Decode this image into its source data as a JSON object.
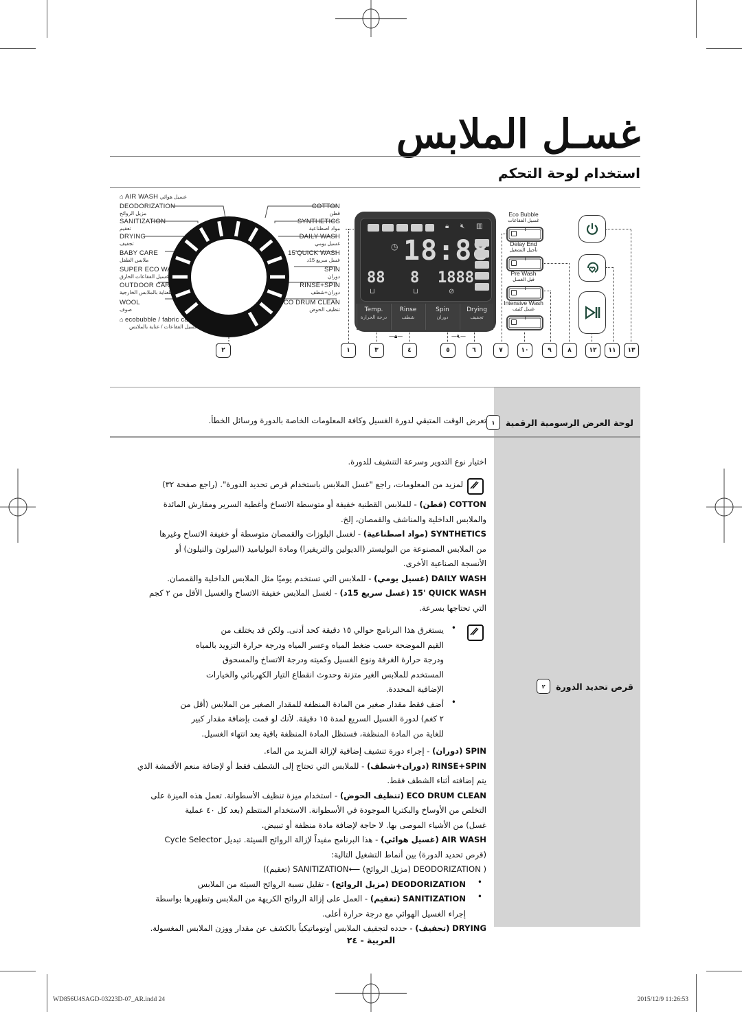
{
  "page": {
    "title": "غسـل الملابس",
    "subtitle": "استخدام لوحة التحكم",
    "page_number": "العربية - ٢٤",
    "footer_file": "WD856U4SAGD-03223D-07_AR.indd   24",
    "footer_timestamp": "2015/12/9   11:26:53"
  },
  "diagram": {
    "air_wash": {
      "en": "AIR WASH",
      "ar": "غسيل هوائي"
    },
    "ecobubble": {
      "en": "ecobubble / fabric care",
      "ar": "غسيل الفقاعات / عناية بالملابس"
    },
    "left_programs": [
      {
        "en": "DEODORIZATION",
        "ar": "مزيل الروائح"
      },
      {
        "en": "SANITIZATION",
        "ar": "تعقيم"
      },
      {
        "en": "DRYING",
        "ar": "تجفيف"
      },
      {
        "en": "BABY CARE",
        "ar": "ملابس الطفل"
      },
      {
        "en": "SUPER ECO WASH",
        "ar": "غسيل الفقاعات الخارق"
      },
      {
        "en": "OUTDOOR CARE",
        "ar": "للعناية بالملابس الخارجية"
      },
      {
        "en": "WOOL",
        "ar": "صوف"
      }
    ],
    "right_programs": [
      {
        "en": "COTTON",
        "ar": "قطن"
      },
      {
        "en": "SYNTHETICS",
        "ar": "مواد اصطناعية"
      },
      {
        "en": "DAILY WASH",
        "ar": "غسيل يومي"
      },
      {
        "en": "15'QUICK WASH",
        "ar": "غسل سريع 15د"
      },
      {
        "en": "SPIN",
        "ar": "دوران"
      },
      {
        "en": "RINSE+SPIN",
        "ar": "دوران+شطف"
      },
      {
        "en": "ECO DRUM CLEAN",
        "ar": "تنظيف الحوض"
      }
    ],
    "display": {
      "time": "18:88",
      "temp": "88",
      "rinse": "8",
      "spin": "1888"
    },
    "panel_buttons": [
      {
        "en": "Temp.",
        "ar": "درجة الحرارة"
      },
      {
        "en": "Rinse",
        "ar": "شطف"
      },
      {
        "en": "Spin",
        "ar": "دوران"
      },
      {
        "en": "Drying",
        "ar": "تجفيف"
      }
    ],
    "option_buttons": [
      {
        "en": "Eco Bubble",
        "ar": "غسيل الفقاعات"
      },
      {
        "en": "Delay End",
        "ar": "تأجيل التشغيل"
      },
      {
        "en": "Pre Wash",
        "ar": "قبل الغسل"
      },
      {
        "en": "Intensive Wash",
        "ar": "غسل كثيف"
      }
    ],
    "callouts": [
      "٢",
      "١",
      "٣",
      "٤",
      "٥",
      "٦",
      "٧",
      "١٠",
      "٩",
      "٨",
      "١٢",
      "١١",
      "١٣"
    ]
  },
  "table": {
    "rows": [
      {
        "number": "١",
        "title": "لوحة العرض الرسومية الرقمية",
        "text": "تعرض الوقت المتبقي لدورة الغسيل وكافة المعلومات الخاصة بالدورة ورسائل الخطأ."
      },
      {
        "number": "٢",
        "title": "قرص تحديد الدورة",
        "intro": "اختيار نوع التدوير وسرعة التنشيف للدورة.",
        "note": "لمزيد من المعلومات، راجع \"غسل الملابس باستخدام قرص تحديد الدورة\". (راجع صفحة ٣٢)",
        "items": [
          {
            "key": "COTTON",
            "ar_key": "(قطن)",
            "lines": [
              "- للملابس القطنية خفيفة أو متوسطة الاتساخ وأغطية السرير ومفارش المائدة",
              "والملابس الداخلية والمناشف والقمصان، إلخ."
            ]
          },
          {
            "key": "SYNTHETICS",
            "ar_key": "(مواد اصطناعية)",
            "lines": [
              "- لغسل البلوزات والقمصان متوسطة أو خفيفة الاتساخ وغيرها",
              "من الملابس المصنوعة من البوليستر (الديولين والتريفيرا) ومادة البولياميد (البيرلون والنيلون) أو",
              "الأنسجة الصناعية الأخرى."
            ]
          },
          {
            "key": "DAILY WASH",
            "ar_key": "(غسيل يومي)",
            "lines": [
              "- للملابس التي تستخدم يوميًا مثل الملابس الداخلية والقمصان."
            ]
          },
          {
            "key": "15' QUICK WASH",
            "ar_key": "(غسل سريع 15د)",
            "lines": [
              "- لغسل الملابس خفيفة الاتساخ والغسيل الأقل من ٢ كجم",
              "التي تحتاجها بسرعة."
            ]
          }
        ],
        "quick_notes": [
          [
            "يستغرق هذا البرنامج حوالي ١٥ دقيقة كحد أدنى. ولكن قد يختلف من",
            "القيم الموضحة حسب ضغط المياه وعسر المياه ودرجة حرارة التزويد بالمياه",
            "ودرجة حرارة الغرفة ونوع الغسيل وكميته ودرجة الاتساخ والمسحوق",
            "المستخدم للملابس الغير متزنة وحدوث انقطاع التيار الكهربائي والخيارات",
            "الإضافية المحددة."
          ],
          [
            "أضف فقط مقدار صغير من المادة المنظفة للمقدار الصغير من الملابس (أقل من",
            "٢ كغم) لدورة الغسيل السريع لمدة ١٥ دقيقة. لأنك لو قمت بإضافة مقدار كبير",
            "للغاية من المادة المنظفة، فستظل المادة المنظفة باقية بعد انتهاء الغسيل."
          ]
        ],
        "items2": [
          {
            "key": "SPIN",
            "ar_key": "(دوران)",
            "lines": [
              "- إجراء دورة تنشيف إضافية لإزالة المزيد من الماء."
            ]
          },
          {
            "key": "RINSE+SPIN",
            "ar_key": "(دوران+شطف)",
            "lines": [
              "- للملابس التي تحتاج إلى الشطف فقط أو لإضافة منعم الأقمشة الذي",
              "يتم إضافته أثناء الشطف فقط."
            ]
          },
          {
            "key": "ECO DRUM CLEAN",
            "ar_key": "(تنظيف الحوض)",
            "lines": [
              "- استخدام ميزة تنظيف الأسطوانة. تعمل هذه الميزة على",
              "التخلص من الأوساخ والبكتريا الموجودة في الأسطوانة. الاستخدام المنتظم (بعد كل ٤٠ عملية",
              "غسل) من الأشياء الموصى بها. لا حاجة لإضافة مادة منظفة أو تبييض."
            ]
          },
          {
            "key": "AIR WASH",
            "ar_key": "(غسيل هوائي)",
            "lines": [
              "- هذا البرنامج مفيداً لإزالة الروائح السيئة.  تبديل Cycle Selector",
              "(قرص تحديد الدورة) بين أنماط التشغيل التالية:",
              "( DEODORIZATION (مزيل الروائح) ⟵SANITIZATION (تعقيم))"
            ]
          }
        ],
        "air_bullets": [
          {
            "key": "DEODORIZATION",
            "ar_key": "(مزيل الروائح)",
            "lines": [
              "- تقليل نسبة الروائح السيئة من الملابس"
            ]
          },
          {
            "key": "SANITIZATION",
            "ar_key": "(تعقيم)",
            "lines": [
              "- العمل على إزالة الروائح الكريهة من الملابس وتطهيرها بواسطة",
              "إجراء الغسيل الهوائي مع درجة حرارة أعلى."
            ]
          }
        ],
        "drying": {
          "key": "DRYING",
          "ar_key": "(تجفيف)",
          "lines": [
            "- حدده لتجفيف الملابس أوتوماتيكياً بالكشف عن مقدار ووزن الملابس المغسولة."
          ]
        }
      }
    ]
  }
}
